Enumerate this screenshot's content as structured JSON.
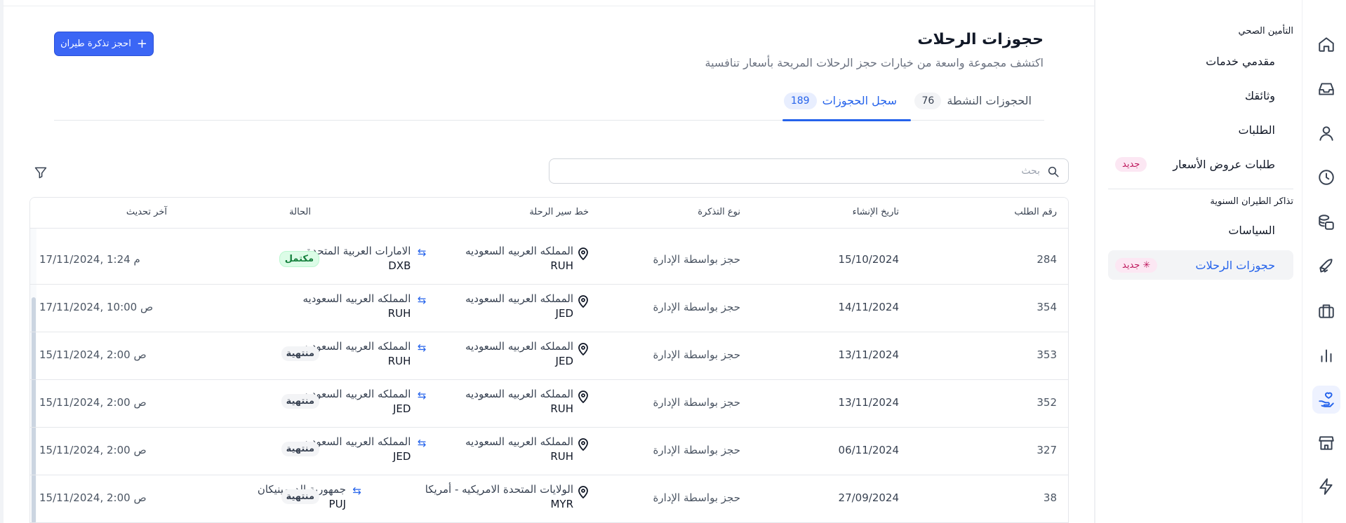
{
  "main": {
    "title": "حجوزات الرحلات",
    "subtitle": "اكتشف مجموعة واسعة من خيارات حجز الرحلات المريحة بأسعار تنافسية",
    "book_button": "احجز تذكرة طيران",
    "tabs": [
      {
        "label": "الحجوزات النشطة",
        "count": "76",
        "active": false
      },
      {
        "label": "سجل الحجوزات",
        "count": "189",
        "active": true
      }
    ],
    "search": {
      "placeholder": "بحث",
      "value": ""
    }
  },
  "sidebar": {
    "section1": "التأمين الصحي",
    "items1": [
      {
        "label": "مقدمي خدمات"
      },
      {
        "label": "وثائقك"
      },
      {
        "label": "الطلبات"
      },
      {
        "label": "طلبات عروض الأسعار",
        "badge": "جديد"
      }
    ],
    "section2": "تذاكر الطيران السنوية",
    "items2": [
      {
        "label": "السياسات"
      },
      {
        "label": "حجوزات الرحلات",
        "badge": "جديد",
        "active": true
      }
    ]
  },
  "rail": {
    "icons": [
      "home-icon",
      "inbox-icon",
      "user-icon",
      "clock-icon",
      "coins-icon",
      "rocket-icon",
      "briefcase-icon",
      "bar-chart-icon",
      "hand-heart-icon",
      "store-icon",
      "lightning-icon"
    ],
    "active": "hand-heart-icon"
  },
  "table": {
    "columns": {
      "id": "رقم الطلب",
      "created": "تاريخ الإنشاء",
      "ticket_type": "نوع التذكرة",
      "route": "خط سير الرحلة",
      "status": "الحالة",
      "updated": "آخر تحديث"
    },
    "rows": [
      {
        "id": "284",
        "created": "15/10/2024",
        "type": "حجز بواسطة الإدارة",
        "from": "المملكه العربيه السعوديه",
        "from_code": "RUH",
        "to": "الامارات العربية المتحدة",
        "to_code": "DXB",
        "status": "مكتمل",
        "status_kind": "done",
        "updated": "17/11/2024, 1:24 م"
      },
      {
        "id": "354",
        "created": "14/11/2024",
        "type": "حجز بواسطة الإدارة",
        "from": "المملكه العربيه السعوديه",
        "from_code": "JED",
        "to": "المملكه العربيه السعوديه",
        "to_code": "RUH",
        "status": "",
        "status_kind": "none",
        "updated": "17/11/2024, 10:00 ص"
      },
      {
        "id": "353",
        "created": "13/11/2024",
        "type": "حجز بواسطة الإدارة",
        "from": "المملكه العربيه السعوديه",
        "from_code": "JED",
        "to": "المملكه العربيه السعوديه",
        "to_code": "RUH",
        "status": "منتهية",
        "status_kind": "ended",
        "updated": "15/11/2024, 2:00 ص"
      },
      {
        "id": "352",
        "created": "13/11/2024",
        "type": "حجز بواسطة الإدارة",
        "from": "المملكه العربيه السعوديه",
        "from_code": "RUH",
        "to": "المملكه العربيه السعوديه",
        "to_code": "JED",
        "status": "منتهية",
        "status_kind": "ended",
        "updated": "15/11/2024, 2:00 ص"
      },
      {
        "id": "327",
        "created": "06/11/2024",
        "type": "حجز بواسطة الإدارة",
        "from": "المملكه العربيه السعوديه",
        "from_code": "RUH",
        "to": "المملكه العربيه السعوديه",
        "to_code": "JED",
        "status": "منتهية",
        "status_kind": "ended",
        "updated": "15/11/2024, 2:00 ص"
      },
      {
        "id": "38",
        "created": "27/09/2024",
        "type": "حجز بواسطة الإدارة",
        "from": "الولايات المتحدة الامريكيه - أمريكا",
        "from_code": "MYR",
        "to": "جمهورية الدومينيكان",
        "to_code": "PUJ",
        "status": "منتهية",
        "status_kind": "ended",
        "updated": "15/11/2024, 2:00 ص"
      }
    ]
  },
  "colors": {
    "accent": "#2563eb",
    "button": "#3b66f5",
    "badge_pink": "#be185d",
    "status_done": "#15803d"
  }
}
